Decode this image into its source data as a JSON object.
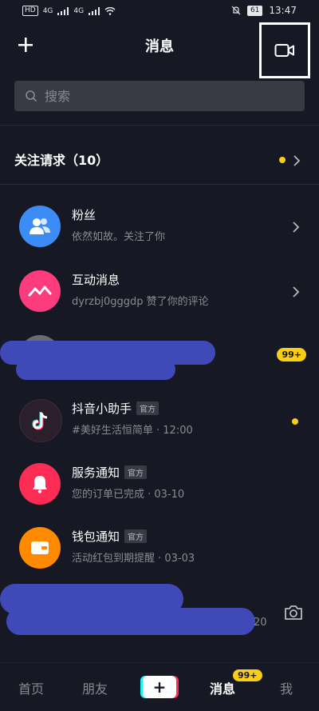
{
  "status_bar": {
    "left": [
      "HD",
      "4G",
      "4G"
    ],
    "battery": "61",
    "time": "13:47"
  },
  "header": {
    "title": "消息"
  },
  "search": {
    "placeholder": "搜索"
  },
  "follow_requests": {
    "label": "关注请求（10）"
  },
  "items": [
    {
      "title": "粉丝",
      "subtitle": "依然如故。关注了你",
      "avatar_color": "#3b8df5",
      "icon": "fans-icon"
    },
    {
      "title": "互动消息",
      "subtitle": "dyrzbj0gggdp 赞了你的评论",
      "avatar_color": "#fd3c7e",
      "icon": "interaction-icon"
    },
    {
      "badge": "99+"
    },
    {
      "title": "抖音小助手",
      "tag": "官方",
      "subtitle": "#美好生活恒简单 · 12:00",
      "avatar_color": "#2a1f2a",
      "icon": "douyin-icon"
    },
    {
      "title": "服务通知",
      "tag": "官方",
      "subtitle": "您的订单已完成 · 03-10",
      "avatar_color": "#fd2c55",
      "icon": "bell-icon"
    },
    {
      "title": "钱包通知",
      "tag": "官方",
      "subtitle": "活动红包到期提醒 · 03-03",
      "avatar_color": "#ff8a00",
      "icon": "wallet-icon"
    },
    {
      "partial_date": "20"
    }
  ],
  "bottom_nav": {
    "home": "首页",
    "friends": "朋友",
    "create": "+",
    "messages": "消息",
    "messages_badge": "99+",
    "me": "我"
  },
  "colors": {
    "background": "#161823",
    "accent_yellow": "#face15",
    "search_bg": "#393b44",
    "muted_text": "#8a8b91"
  }
}
